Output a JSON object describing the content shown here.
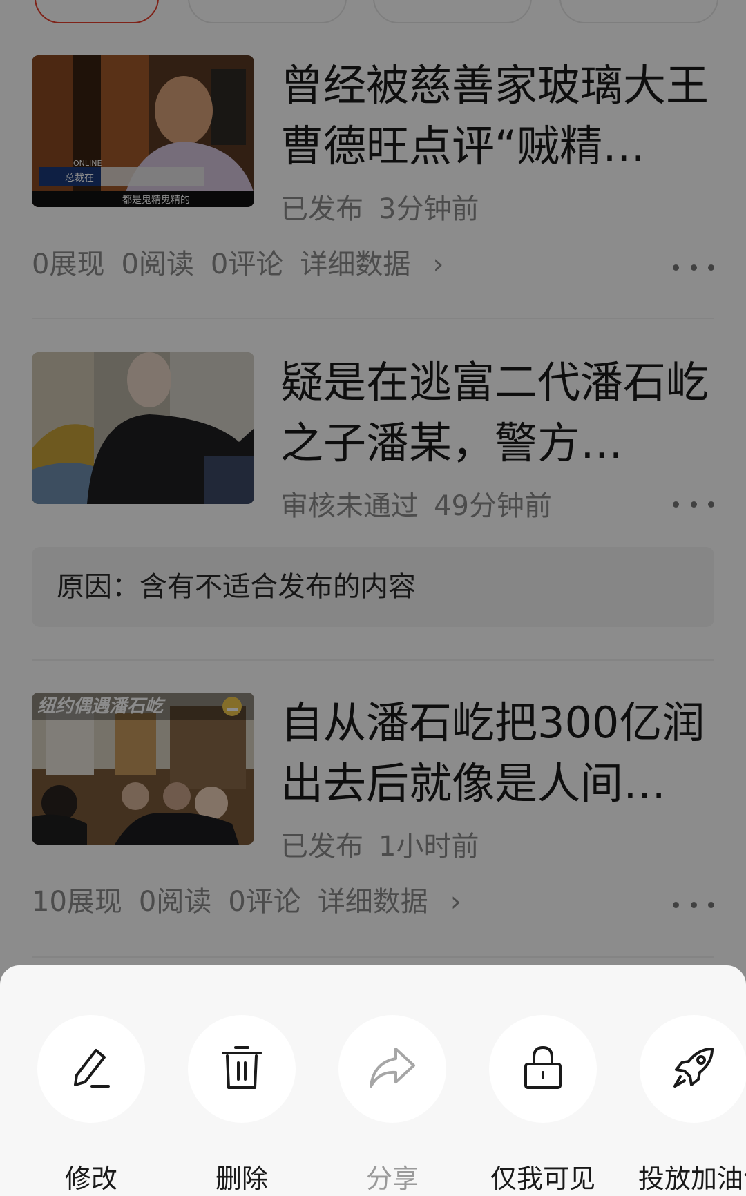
{
  "posts": [
    {
      "title": "曾经被慈善家玻璃大王曹德旺点评“贼精…",
      "status": "已发布",
      "time": "3分钟前",
      "stats": [
        "0展现",
        "0阅读",
        "0评论"
      ],
      "detail_link": "详细数据",
      "thumb_caption": "都是鬼精鬼精的",
      "thumb_tag": "总裁在",
      "thumb_logo": "ONLINE"
    },
    {
      "title": "疑是在逃富二代潘石屹之子潘某，警方…",
      "status": "审核未通过",
      "time": "49分钟前",
      "reason": "原因：含有不适合发布的内容"
    },
    {
      "title": "自从潘石屹把300亿润出去后就像是人间…",
      "status": "已发布",
      "time": "1小时前",
      "stats": [
        "10展现",
        "0阅读",
        "0评论"
      ],
      "detail_link": "详细数据",
      "thumb_caption": "纽约偶遇潘石屹"
    }
  ],
  "actions": [
    {
      "label": "修改",
      "icon": "pencil-icon",
      "enabled": true
    },
    {
      "label": "删除",
      "icon": "trash-icon",
      "enabled": true
    },
    {
      "label": "分享",
      "icon": "share-arrow-icon",
      "enabled": false
    },
    {
      "label": "仅我可见",
      "icon": "lock-icon",
      "enabled": true
    },
    {
      "label": "投放加油包",
      "icon": "rocket-icon",
      "enabled": true
    }
  ],
  "colors": {
    "accent": "#e8402e",
    "secondary_text": "#8a8a8a",
    "sheet_bg": "#f7f7f7"
  }
}
